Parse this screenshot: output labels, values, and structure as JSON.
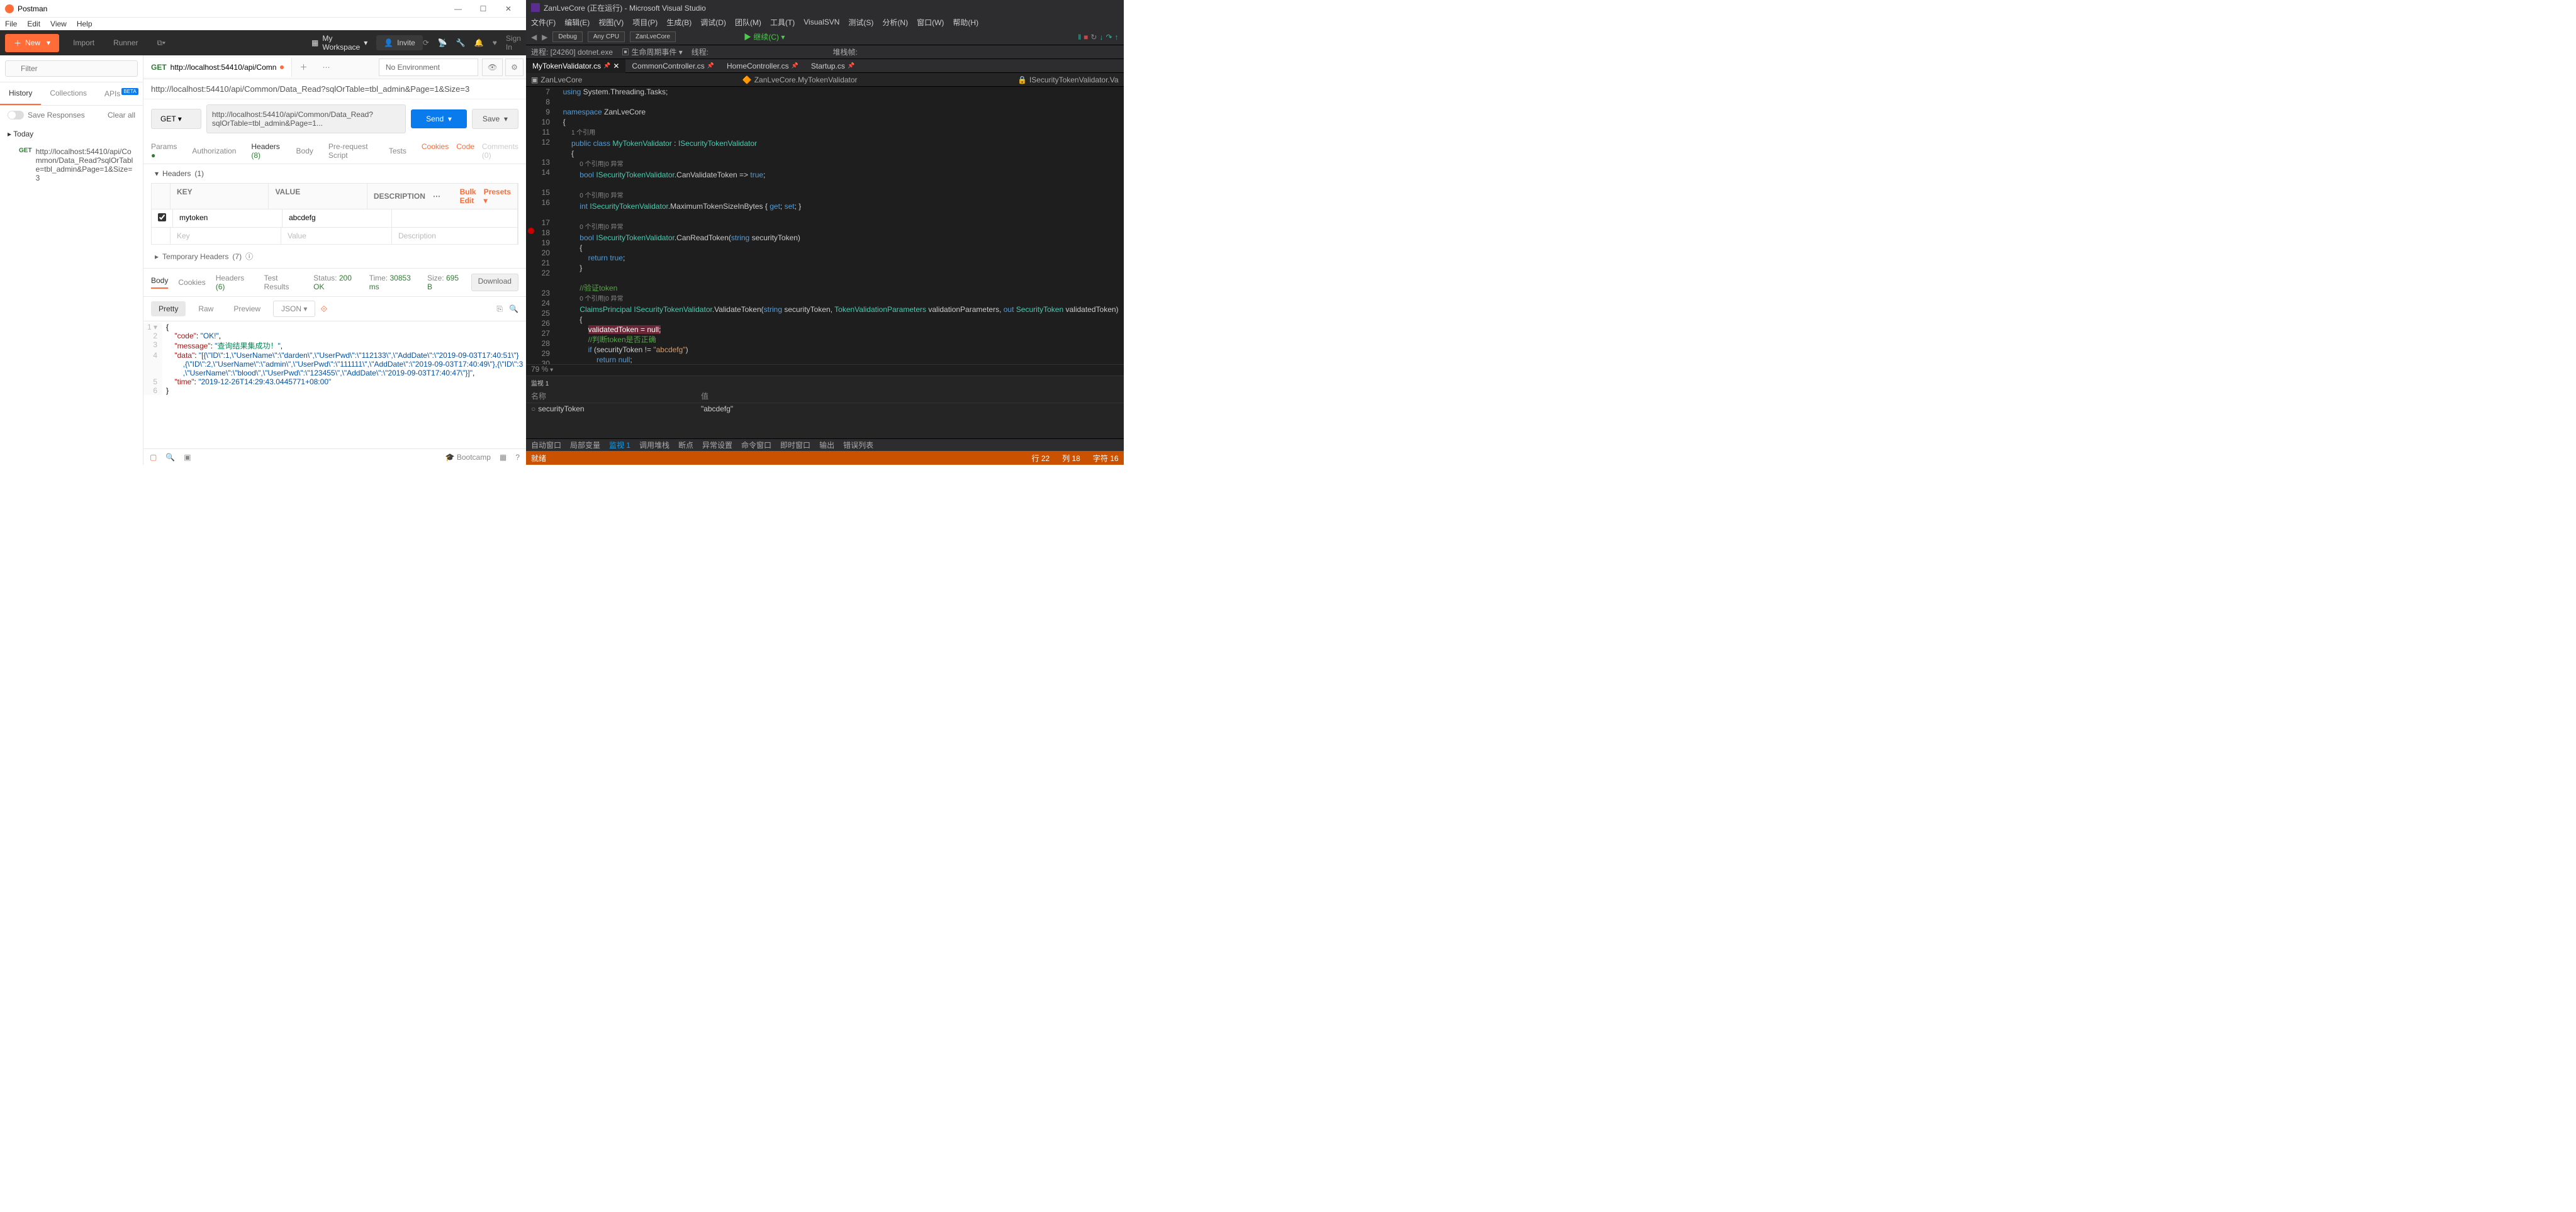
{
  "postman": {
    "title": "Postman",
    "menu": [
      "File",
      "Edit",
      "View",
      "Help"
    ],
    "toolbar": {
      "new": "New",
      "import": "Import",
      "runner": "Runner",
      "workspace": "My Workspace",
      "invite": "Invite",
      "signin": "Sign In"
    },
    "filter_placeholder": "Filter",
    "sidebar_tabs": {
      "history": "History",
      "collections": "Collections",
      "apis": "APIs",
      "beta": "BETA"
    },
    "save_responses": "Save Responses",
    "clear_all": "Clear all",
    "today": "Today",
    "hist_get": "GET",
    "hist_url": "http://localhost:54410/api/Common/Data_Read?sqlOrTable=tbl_admin&Page=1&Size=3",
    "reqtab": {
      "method": "GET",
      "label": "http://localhost:54410/api/Comn"
    },
    "env": "No Environment",
    "url_display": "http://localhost:54410/api/Common/Data_Read?sqlOrTable=tbl_admin&Page=1&Size=3",
    "method": "GET",
    "url_input": "http://localhost:54410/api/Common/Data_Read?sqlOrTable=tbl_admin&Page=1...",
    "send": "Send",
    "save": "Save",
    "subtabs": {
      "params": "Params",
      "auth": "Authorization",
      "headers": "Headers",
      "headers_count": "(8)",
      "body": "Body",
      "prereq": "Pre-request Script",
      "tests": "Tests",
      "cookies": "Cookies",
      "code": "Code",
      "comments": "Comments (0)"
    },
    "headers_title": "Headers",
    "headers_count_title": "(1)",
    "table": {
      "key": "KEY",
      "value": "VALUE",
      "desc": "DESCRIPTION",
      "bulk": "Bulk Edit",
      "presets": "Presets",
      "r1_key": "mytoken",
      "r1_val": "abcdefg",
      "ph_key": "Key",
      "ph_val": "Value",
      "ph_desc": "Description"
    },
    "temp_headers": "Temporary Headers",
    "temp_count": "(7)",
    "resp_tabs": {
      "body": "Body",
      "cookies": "Cookies",
      "headers": "Headers",
      "hcount": "(6)",
      "tests": "Test Results"
    },
    "status": {
      "label": "Status:",
      "code": "200 OK",
      "time_label": "Time:",
      "time": "30853 ms",
      "size_label": "Size:",
      "size": "695 B",
      "download": "Download"
    },
    "pretty": {
      "pretty": "Pretty",
      "raw": "Raw",
      "preview": "Preview",
      "json": "JSON"
    },
    "footer": {
      "bootcamp": "Bootcamp"
    }
  },
  "vs": {
    "title": "ZanLveCore (正在运行) - Microsoft Visual Studio",
    "menu": [
      "文件(F)",
      "编辑(E)",
      "视图(V)",
      "项目(P)",
      "生成(B)",
      "调试(D)",
      "团队(M)",
      "工具(T)",
      "VisualSVN",
      "测试(S)",
      "分析(N)",
      "窗口(W)",
      "帮助(H)"
    ],
    "toolbar": {
      "debug": "Debug",
      "cpu": "Any CPU",
      "proj": "ZanLveCore",
      "cont": "继续(C)"
    },
    "process": {
      "label": "进程:",
      "val": "[24260] dotnet.exe",
      "lifecycle": "生命周期事件",
      "thread": "线程:",
      "stack": "堆栈帧:"
    },
    "tabs": [
      "MyTokenValidator.cs",
      "CommonController.cs",
      "HomeController.cs",
      "Startup.cs"
    ],
    "nav": {
      "proj": "ZanLveCore",
      "cls": "ZanLveCore.MyTokenValidator",
      "method": "ISecurityTokenValidator.Va"
    },
    "zoom": "79 %",
    "watch": {
      "title": "监视 1",
      "name_hdr": "名称",
      "val_hdr": "值",
      "name": "securityToken",
      "val": "\"abcdefg\""
    },
    "bottom_tabs": [
      "自动窗口",
      "局部变量",
      "监视 1",
      "调用堆栈",
      "断点",
      "异常设置",
      "命令窗口",
      "即时窗口",
      "输出",
      "错误列表"
    ],
    "status": {
      "ready": "就绪",
      "line": "行 22",
      "col": "列 18",
      "char": "字符 16"
    }
  }
}
